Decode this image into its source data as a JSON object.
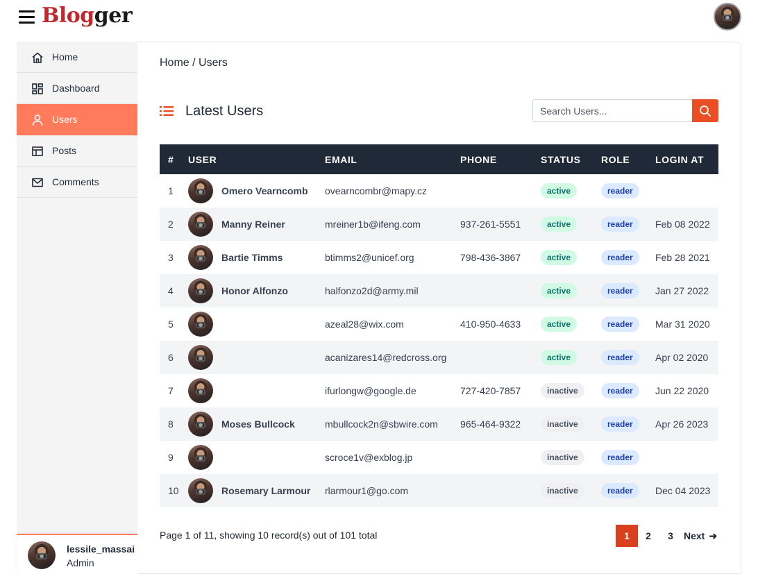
{
  "app": {
    "logo_part1": "Blog",
    "logo_part2": "ger"
  },
  "sidebar": {
    "items": [
      {
        "label": "Home",
        "icon": "home-icon"
      },
      {
        "label": "Dashboard",
        "icon": "dashboard-icon"
      },
      {
        "label": "Users",
        "icon": "user-icon",
        "active": true
      },
      {
        "label": "Posts",
        "icon": "table-icon"
      },
      {
        "label": "Comments",
        "icon": "mail-icon"
      }
    ],
    "user": {
      "name": "lessile_massai",
      "role": "Admin"
    }
  },
  "main": {
    "breadcrumb": "Home / Users",
    "title": "Latest Users",
    "search": {
      "placeholder": "Search Users...",
      "value": ""
    },
    "table": {
      "columns": [
        "#",
        "USER",
        "EMAIL",
        "PHONE",
        "STATUS",
        "ROLE",
        "LOGIN AT"
      ],
      "rows": [
        {
          "num": "1",
          "name": "Omero Vearncomb",
          "email": "ovearncombr@mapy.cz",
          "phone": "",
          "status": "active",
          "role": "reader",
          "login": ""
        },
        {
          "num": "2",
          "name": "Manny Reiner",
          "email": "mreiner1b@ifeng.com",
          "phone": "937-261-5551",
          "status": "active",
          "role": "reader",
          "login": "Feb 08 2022"
        },
        {
          "num": "3",
          "name": "Bartie Timms",
          "email": "btimms2@unicef.org",
          "phone": "798-436-3867",
          "status": "active",
          "role": "reader",
          "login": "Feb 28 2021"
        },
        {
          "num": "4",
          "name": "Honor Alfonzo",
          "email": "halfonzo2d@army.mil",
          "phone": "",
          "status": "active",
          "role": "reader",
          "login": "Jan 27 2022"
        },
        {
          "num": "5",
          "name": "",
          "email": "azeal28@wix.com",
          "phone": "410-950-4633",
          "status": "active",
          "role": "reader",
          "login": "Mar 31 2020"
        },
        {
          "num": "6",
          "name": "",
          "email": "acanizares14@redcross.org",
          "phone": "",
          "status": "active",
          "role": "reader",
          "login": "Apr 02 2020"
        },
        {
          "num": "7",
          "name": "",
          "email": "ifurlongw@google.de",
          "phone": "727-420-7857",
          "status": "inactive",
          "role": "reader",
          "login": "Jun 22 2020"
        },
        {
          "num": "8",
          "name": "Moses Bullcock",
          "email": "mbullcock2n@sbwire.com",
          "phone": "965-464-9322",
          "status": "inactive",
          "role": "reader",
          "login": "Apr 26 2023"
        },
        {
          "num": "9",
          "name": "",
          "email": "scroce1v@exblog.jp",
          "phone": "",
          "status": "inactive",
          "role": "reader",
          "login": ""
        },
        {
          "num": "10",
          "name": "Rosemary Larmour",
          "email": "rlarmour1@go.com",
          "phone": "",
          "status": "inactive",
          "role": "reader",
          "login": "Dec 04 2023"
        }
      ]
    },
    "footer": {
      "page_info": "Page 1 of 11, showing 10 record(s) out of 101 total",
      "pages": [
        "1",
        "2",
        "3"
      ],
      "current_page": "1",
      "next_label": "Next"
    }
  },
  "colors": {
    "accent": "#e94e24",
    "active_nav": "#ff7b5c",
    "table_header": "#1f2937",
    "logo_red": "#c0282d"
  }
}
